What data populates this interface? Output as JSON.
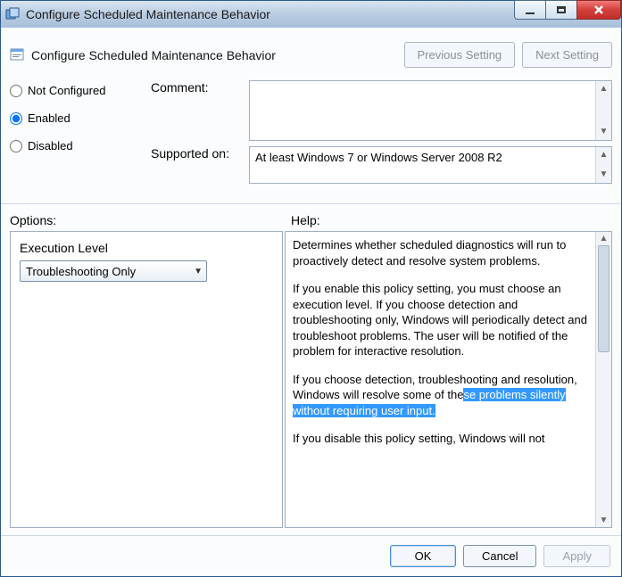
{
  "window": {
    "title": "Configure Scheduled Maintenance Behavior"
  },
  "header": {
    "title": "Configure Scheduled Maintenance Behavior",
    "prev_btn": "Previous Setting",
    "next_btn": "Next Setting"
  },
  "radios": {
    "not_configured": "Not Configured",
    "enabled": "Enabled",
    "disabled": "Disabled",
    "selected": "enabled"
  },
  "fields": {
    "comment_label": "Comment:",
    "comment_text": "",
    "supported_label": "Supported on:",
    "supported_text": "At least Windows 7 or Windows Server 2008 R2"
  },
  "labels": {
    "options": "Options:",
    "help": "Help:"
  },
  "options": {
    "execution_label": "Execution Level",
    "execution_value": "Troubleshooting Only"
  },
  "help": {
    "p1": "Determines whether scheduled diagnostics will run to proactively detect and resolve system problems.",
    "p2": "If you enable this policy setting, you must choose an execution level.  If you choose detection and troubleshooting only, Windows will periodically detect and troubleshoot problems.  The user will be notified of the problem for interactive resolution.",
    "p3a": "If you choose detection, troubleshooting and resolution, Windows will resolve some of the",
    "p3b": "se problems silently without requiring user input.",
    "p4": "If you disable this policy setting, Windows will not"
  },
  "footer": {
    "ok": "OK",
    "cancel": "Cancel",
    "apply": "Apply"
  }
}
